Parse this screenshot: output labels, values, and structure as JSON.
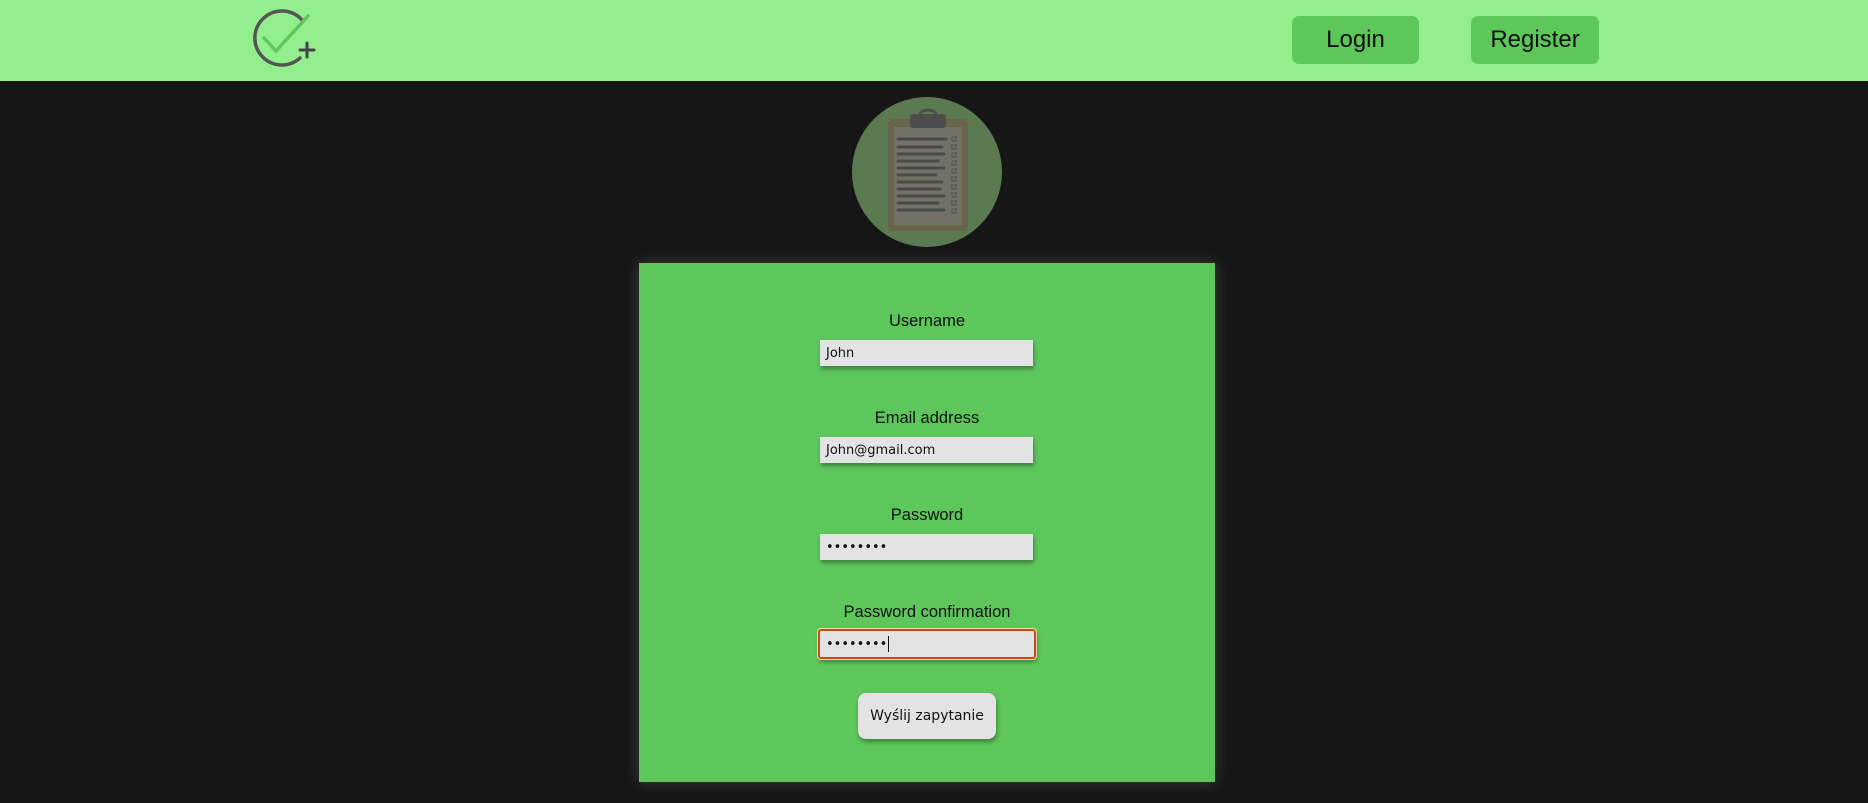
{
  "header": {
    "logo_icon": "check-plus-icon",
    "login_label": "Login",
    "register_label": "Register"
  },
  "avatar": {
    "icon": "clipboard-icon"
  },
  "form": {
    "username_label": "Username",
    "username_value": "John",
    "email_label": "Email address",
    "email_value": "John@gmail.com",
    "password_label": "Password",
    "password_value": "••••••••",
    "password_confirmation_label": "Password confirmation",
    "password_confirmation_value": "••••••••",
    "submit_label": "Wyślij zapytanie"
  },
  "colors": {
    "header_bg": "#93ef8e",
    "page_bg": "#161616",
    "card_bg": "#5dc75b",
    "button_bg": "#5ec75a",
    "focus_border": "#c94b14"
  }
}
